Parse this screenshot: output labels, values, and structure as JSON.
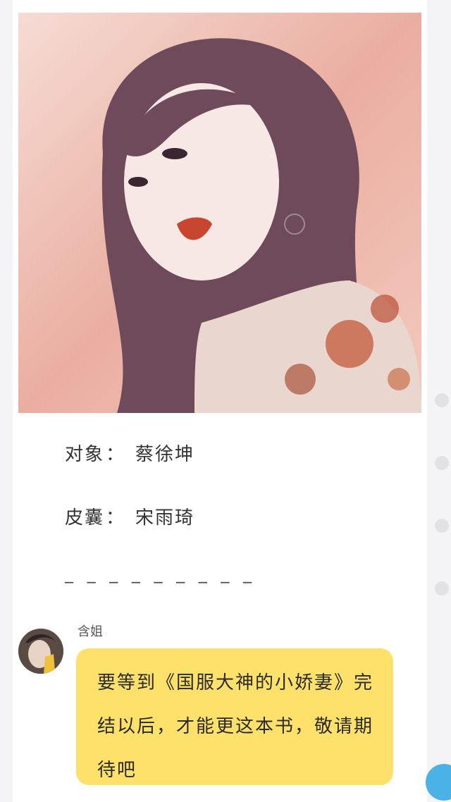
{
  "profile": {
    "target_label": "对象",
    "target_value": "蔡徐坤",
    "skin_label": "皮囊",
    "skin_value": "宋雨琦",
    "separator": "：",
    "divider": "_ _ _ _ _ _ _ _ _"
  },
  "chat": {
    "sender_name": "含姐",
    "message": "要等到《国服大神的小娇妻》完结以后，才能更这本书，敬请期待吧"
  },
  "colors": {
    "bubble": "#fde16a",
    "fab": "#4bb2e8",
    "page_bg": "#f4f4f6"
  }
}
